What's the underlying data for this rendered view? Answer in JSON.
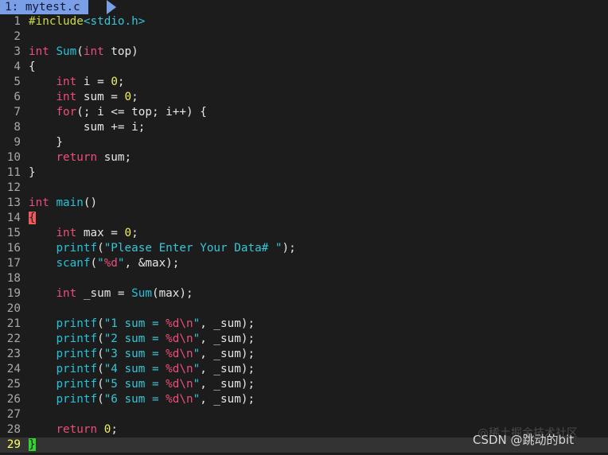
{
  "tab": {
    "number": "1:",
    "filename": "mytest.c"
  },
  "lines": [
    {
      "n": "1",
      "tokens": [
        {
          "c": "pre",
          "t": "#include"
        },
        {
          "c": "inc",
          "t": "<stdio.h>"
        }
      ]
    },
    {
      "n": "2",
      "tokens": []
    },
    {
      "n": "3",
      "tokens": [
        {
          "c": "kw",
          "t": "int"
        },
        {
          "c": "plain",
          "t": " "
        },
        {
          "c": "fn",
          "t": "Sum"
        },
        {
          "c": "plain",
          "t": "("
        },
        {
          "c": "kw",
          "t": "int"
        },
        {
          "c": "plain",
          "t": " top)"
        }
      ]
    },
    {
      "n": "4",
      "tokens": [
        {
          "c": "plain",
          "t": "{"
        }
      ]
    },
    {
      "n": "5",
      "tokens": [
        {
          "c": "plain",
          "t": "    "
        },
        {
          "c": "kw",
          "t": "int"
        },
        {
          "c": "plain",
          "t": " i = "
        },
        {
          "c": "num",
          "t": "0"
        },
        {
          "c": "plain",
          "t": ";"
        }
      ]
    },
    {
      "n": "6",
      "tokens": [
        {
          "c": "plain",
          "t": "    "
        },
        {
          "c": "kw",
          "t": "int"
        },
        {
          "c": "plain",
          "t": " sum = "
        },
        {
          "c": "num",
          "t": "0"
        },
        {
          "c": "plain",
          "t": ";"
        }
      ]
    },
    {
      "n": "7",
      "tokens": [
        {
          "c": "plain",
          "t": "    "
        },
        {
          "c": "kw",
          "t": "for"
        },
        {
          "c": "plain",
          "t": "(; i <= top; i++) {"
        }
      ]
    },
    {
      "n": "8",
      "tokens": [
        {
          "c": "plain",
          "t": "        sum += i;"
        }
      ]
    },
    {
      "n": "9",
      "tokens": [
        {
          "c": "plain",
          "t": "    }"
        }
      ]
    },
    {
      "n": "10",
      "tokens": [
        {
          "c": "plain",
          "t": "    "
        },
        {
          "c": "kw",
          "t": "return"
        },
        {
          "c": "plain",
          "t": " sum;"
        }
      ]
    },
    {
      "n": "11",
      "tokens": [
        {
          "c": "plain",
          "t": "}"
        }
      ]
    },
    {
      "n": "12",
      "tokens": []
    },
    {
      "n": "13",
      "tokens": [
        {
          "c": "kw",
          "t": "int"
        },
        {
          "c": "plain",
          "t": " "
        },
        {
          "c": "fn",
          "t": "main"
        },
        {
          "c": "plain",
          "t": "()"
        }
      ]
    },
    {
      "n": "14",
      "tokens": [
        {
          "c": "cursor",
          "t": "{"
        }
      ]
    },
    {
      "n": "15",
      "tokens": [
        {
          "c": "plain",
          "t": "    "
        },
        {
          "c": "kw",
          "t": "int"
        },
        {
          "c": "plain",
          "t": " max = "
        },
        {
          "c": "num",
          "t": "0"
        },
        {
          "c": "plain",
          "t": ";"
        }
      ]
    },
    {
      "n": "16",
      "tokens": [
        {
          "c": "plain",
          "t": "    "
        },
        {
          "c": "fn",
          "t": "printf"
        },
        {
          "c": "plain",
          "t": "("
        },
        {
          "c": "str",
          "t": "\"Please Enter Your Data# \""
        },
        {
          "c": "plain",
          "t": ");"
        }
      ]
    },
    {
      "n": "17",
      "tokens": [
        {
          "c": "plain",
          "t": "    "
        },
        {
          "c": "fn",
          "t": "scanf"
        },
        {
          "c": "plain",
          "t": "("
        },
        {
          "c": "str",
          "t": "\""
        },
        {
          "c": "fmt",
          "t": "%d"
        },
        {
          "c": "str",
          "t": "\""
        },
        {
          "c": "plain",
          "t": ", &max);"
        }
      ]
    },
    {
      "n": "18",
      "tokens": []
    },
    {
      "n": "19",
      "tokens": [
        {
          "c": "plain",
          "t": "    "
        },
        {
          "c": "kw",
          "t": "int"
        },
        {
          "c": "plain",
          "t": " _sum = "
        },
        {
          "c": "fn",
          "t": "Sum"
        },
        {
          "c": "plain",
          "t": "(max);"
        }
      ]
    },
    {
      "n": "20",
      "tokens": []
    },
    {
      "n": "21",
      "tokens": [
        {
          "c": "plain",
          "t": "    "
        },
        {
          "c": "fn",
          "t": "printf"
        },
        {
          "c": "plain",
          "t": "("
        },
        {
          "c": "str",
          "t": "\"1 sum = "
        },
        {
          "c": "fmt",
          "t": "%d\\n"
        },
        {
          "c": "str",
          "t": "\""
        },
        {
          "c": "plain",
          "t": ", _sum);"
        }
      ]
    },
    {
      "n": "22",
      "tokens": [
        {
          "c": "plain",
          "t": "    "
        },
        {
          "c": "fn",
          "t": "printf"
        },
        {
          "c": "plain",
          "t": "("
        },
        {
          "c": "str",
          "t": "\"2 sum = "
        },
        {
          "c": "fmt",
          "t": "%d\\n"
        },
        {
          "c": "str",
          "t": "\""
        },
        {
          "c": "plain",
          "t": ", _sum);"
        }
      ]
    },
    {
      "n": "23",
      "tokens": [
        {
          "c": "plain",
          "t": "    "
        },
        {
          "c": "fn",
          "t": "printf"
        },
        {
          "c": "plain",
          "t": "("
        },
        {
          "c": "str",
          "t": "\"3 sum = "
        },
        {
          "c": "fmt",
          "t": "%d\\n"
        },
        {
          "c": "str",
          "t": "\""
        },
        {
          "c": "plain",
          "t": ", _sum);"
        }
      ]
    },
    {
      "n": "24",
      "tokens": [
        {
          "c": "plain",
          "t": "    "
        },
        {
          "c": "fn",
          "t": "printf"
        },
        {
          "c": "plain",
          "t": "("
        },
        {
          "c": "str",
          "t": "\"4 sum = "
        },
        {
          "c": "fmt",
          "t": "%d\\n"
        },
        {
          "c": "str",
          "t": "\""
        },
        {
          "c": "plain",
          "t": ", _sum);"
        }
      ]
    },
    {
      "n": "25",
      "tokens": [
        {
          "c": "plain",
          "t": "    "
        },
        {
          "c": "fn",
          "t": "printf"
        },
        {
          "c": "plain",
          "t": "("
        },
        {
          "c": "str",
          "t": "\"5 sum = "
        },
        {
          "c": "fmt",
          "t": "%d\\n"
        },
        {
          "c": "str",
          "t": "\""
        },
        {
          "c": "plain",
          "t": ", _sum);"
        }
      ]
    },
    {
      "n": "26",
      "tokens": [
        {
          "c": "plain",
          "t": "    "
        },
        {
          "c": "fn",
          "t": "printf"
        },
        {
          "c": "plain",
          "t": "("
        },
        {
          "c": "str",
          "t": "\"6 sum = "
        },
        {
          "c": "fmt",
          "t": "%d\\n"
        },
        {
          "c": "str",
          "t": "\""
        },
        {
          "c": "plain",
          "t": ", _sum);"
        }
      ]
    },
    {
      "n": "27",
      "tokens": []
    },
    {
      "n": "28",
      "tokens": [
        {
          "c": "plain",
          "t": "    "
        },
        {
          "c": "kw",
          "t": "return"
        },
        {
          "c": "plain",
          "t": " "
        },
        {
          "c": "num",
          "t": "0"
        },
        {
          "c": "plain",
          "t": ";"
        }
      ]
    },
    {
      "n": "29",
      "current": true,
      "tokens": [
        {
          "c": "cursor2",
          "t": "}"
        }
      ]
    }
  ],
  "watermark": {
    "line1": "@稀土掘金技术社区",
    "line2": "CSDN @跳动的bit"
  },
  "colors": {
    "background": "#1c1c1c",
    "tab": "#7b9fe6",
    "keyword": "#ee4d7a",
    "function": "#22c3d8",
    "number": "#f0f060",
    "preprocessor": "#c8dc3c",
    "cursor_open": "#f15a5a",
    "cursor_close": "#2fd62f"
  }
}
